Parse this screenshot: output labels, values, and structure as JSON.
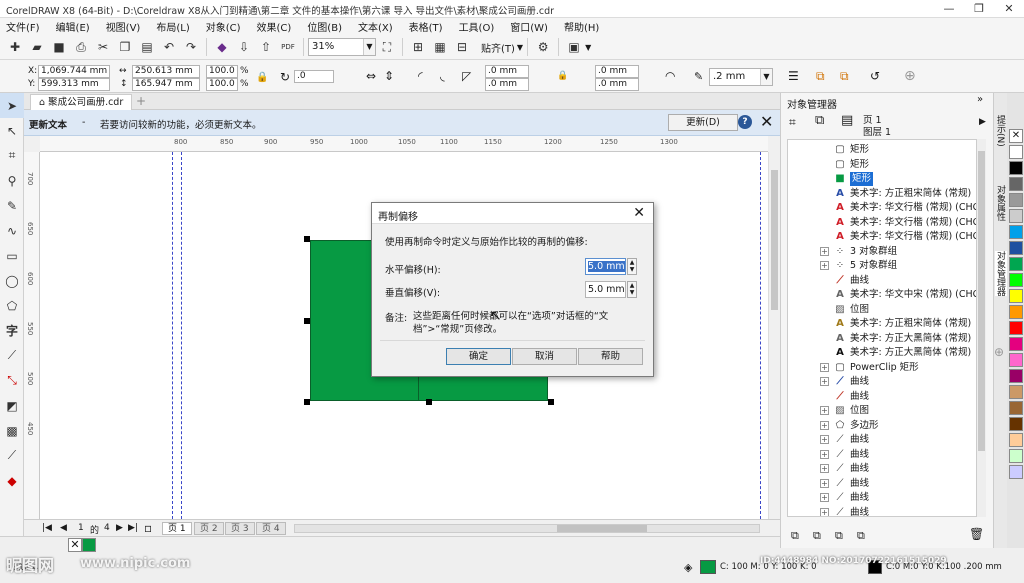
{
  "window": {
    "title": "CorelDRAW X8 (64-Bit) - D:\\Coreldraw X8从入门到精通\\第二章 文件的基本操作\\第六课 导入 导出文件\\素材\\聚成公司画册.cdr",
    "minimize": "—",
    "restore": "❐",
    "close": "✕"
  },
  "menu": [
    "文件(F)",
    "编辑(E)",
    "视图(V)",
    "布局(L)",
    "对象(C)",
    "效果(C)",
    "位图(B)",
    "文本(X)",
    "表格(T)",
    "工具(O)",
    "窗口(W)",
    "帮助(H)"
  ],
  "toolbar": {
    "zoom": "31%",
    "snap_label": "贴齐(T)"
  },
  "propbar": {
    "x_label": "X:",
    "x": "1,069.744 mm",
    "y_label": "Y:",
    "y": "599.313 mm",
    "w": "250.613 mm",
    "h": "165.947 mm",
    "scale_w": "100.0",
    "scale_h": "100.0",
    "pct": "%",
    "rotation": ".0",
    "corner1": ".0 mm",
    "corner2": ".0 mm",
    "corner3": ".0 mm",
    "corner4": ".0 mm",
    "outline": ".2 mm"
  },
  "tabs": {
    "doc": "聚成公司画册.cdr",
    "add": "+"
  },
  "notice": {
    "title": "更新文本",
    "dash": "-",
    "message": "若要访问较新的功能，必须更新文本。",
    "button": "更新(D)",
    "help": "?",
    "close": "✕"
  },
  "ruler": {
    "h_ticks": [
      "800",
      "850",
      "900",
      "950",
      "1000",
      "1050",
      "1100",
      "1150",
      "1200",
      "1250",
      "1300"
    ],
    "v_ticks": [
      "700",
      "650",
      "600",
      "550",
      "500",
      "450"
    ]
  },
  "dialog": {
    "title": "再制偏移",
    "close": "✕",
    "prompt": "使用再制命令时定义与原始作比较的再制的偏移:",
    "h_label": "水平偏移(H):",
    "h_value": "5.0 mm",
    "v_label": "垂直偏移(V):",
    "v_value": "5.0 mm",
    "note_label": "备注:",
    "note": "这些距离任何时候都可以在“选项”对话框的“文档”>“常规”页修改。",
    "ok": "确定",
    "cancel": "取消",
    "help": "帮助"
  },
  "pages": {
    "first": "1",
    "of": "的",
    "total": "4",
    "tabs": [
      "页 1",
      "页 2",
      "页 3",
      "页 4"
    ]
  },
  "status": {
    "cursor": "( 814.4",
    "fill_info": "C: 100 M: 0 Y: 100 K: 0",
    "outline_info": "C:0 M:0 Y:0 K:100  .200 mm"
  },
  "objmgr": {
    "title": "对象管理器",
    "page": "页 1",
    "layer": "图层 1",
    "rows": [
      {
        "label": "矩形",
        "icon": "rect-outline",
        "exp": false
      },
      {
        "label": "矩形",
        "icon": "rect-outline",
        "exp": false
      },
      {
        "label": "矩形",
        "icon": "rect-green",
        "exp": false,
        "selected": true
      },
      {
        "label": "美术字: 方正粗宋简体 (常规)",
        "icon": "A-blue",
        "exp": false
      },
      {
        "label": "美术字: 华文行楷 (常规) (CHC",
        "icon": "A-red",
        "exp": false
      },
      {
        "label": "美术字: 华文行楷 (常规) (CHC",
        "icon": "A-red",
        "exp": false
      },
      {
        "label": "美术字: 华文行楷 (常规) (CHC",
        "icon": "A-red",
        "exp": false
      },
      {
        "label": "3 对象群组",
        "icon": "group",
        "exp": true
      },
      {
        "label": "5 对象群组",
        "icon": "group",
        "exp": true
      },
      {
        "label": "曲线",
        "icon": "curve-red",
        "exp": false
      },
      {
        "label": "美术字: 华文中宋 (常规) (CHC",
        "icon": "A-gray",
        "exp": false
      },
      {
        "label": "位图",
        "icon": "bitmap",
        "exp": false
      },
      {
        "label": "美术字: 方正粗宋简体 (常规)",
        "icon": "A-gold",
        "exp": false
      },
      {
        "label": "美术字: 方正大黑简体 (常规)",
        "icon": "A-gray",
        "exp": false
      },
      {
        "label": "美术字: 方正大黑简体 (常规)",
        "icon": "A-black",
        "exp": false
      },
      {
        "label": "PowerClip 矩形",
        "icon": "rect-outline",
        "exp": true
      },
      {
        "label": "曲线",
        "icon": "curve-blue",
        "exp": true
      },
      {
        "label": "曲线",
        "icon": "curve-red",
        "exp": false
      },
      {
        "label": "位图",
        "icon": "bitmap",
        "exp": true
      },
      {
        "label": "多边形",
        "icon": "polygon",
        "exp": true
      },
      {
        "label": "曲线",
        "icon": "curve",
        "exp": true
      },
      {
        "label": "曲线",
        "icon": "curve",
        "exp": true
      },
      {
        "label": "曲线",
        "icon": "curve",
        "exp": true
      },
      {
        "label": "曲线",
        "icon": "curve",
        "exp": true
      },
      {
        "label": "曲线",
        "icon": "curve",
        "exp": true
      },
      {
        "label": "曲线",
        "icon": "curve",
        "exp": true
      }
    ]
  },
  "side_tabs": [
    "提示(N)",
    "对象属性",
    "对象管理器"
  ],
  "palette": [
    "#ffffff",
    "#000000",
    "#666666",
    "#999999",
    "#cccccc",
    "#00a0e9",
    "#1e50a0",
    "#00a650",
    "#00ff00",
    "#ffff00",
    "#ff9900",
    "#ff0000",
    "#e4007f",
    "#ff66cc",
    "#990066",
    "#cc9966",
    "#996633",
    "#663300",
    "#ffcc99",
    "#ccffcc",
    "#ccccff"
  ],
  "watermark": {
    "left": "昵图网",
    "url": "www.nipic.com",
    "id": "ID:4448984 NO:20170722161515029"
  },
  "colors": {
    "shape_green": "#079a43",
    "notice_bg": "#dde8f5",
    "guide_blue": "#3a46c8"
  }
}
